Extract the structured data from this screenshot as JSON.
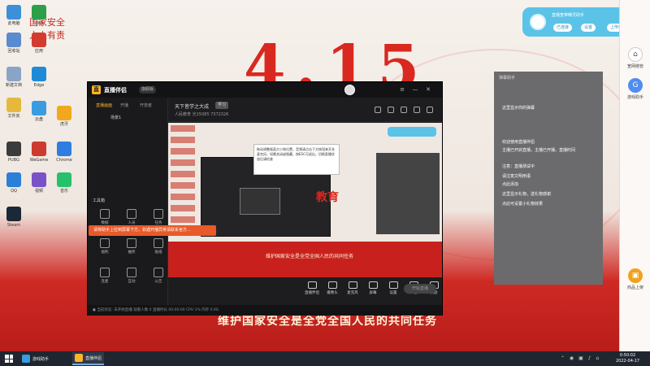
{
  "wallpaper": {
    "motto_line1": "国家安全",
    "motto_line2": "人人有责",
    "big_text": "4.15",
    "slogan": "维护国家安全是全党全国人民的共同任务"
  },
  "desktop_icons": [
    {
      "name": "computer",
      "label": "此电脑",
      "color": "#3d8fd8"
    },
    {
      "name": "recycle",
      "label": "回收站",
      "color": "#5a8bd0"
    },
    {
      "name": "file",
      "label": "新建文档",
      "color": "#8aa4c7"
    },
    {
      "name": "folder",
      "label": "文件夹",
      "color": "#e6b93c"
    },
    {
      "name": "app-360",
      "label": "360",
      "color": "#2c9f4b"
    },
    {
      "name": "pubg",
      "label": "PUBG",
      "color": "#3b3b3b"
    },
    {
      "name": "qq",
      "label": "QQ",
      "color": "#2a7fd8"
    },
    {
      "name": "steam",
      "label": "Steam",
      "color": "#1b2838"
    },
    {
      "name": "app-red",
      "label": "应用",
      "color": "#d33b30"
    },
    {
      "name": "weixin",
      "label": "WeGame",
      "color": "#cd3b2f"
    },
    {
      "name": "huya",
      "label": "虎牙",
      "color": "#f0a81c"
    },
    {
      "name": "chrome",
      "label": "Chrome",
      "color": "#2e7de0"
    },
    {
      "name": "edge",
      "label": "Edge",
      "color": "#1f8bd6"
    },
    {
      "name": "qq-music",
      "label": "音乐",
      "color": "#27c06b"
    },
    {
      "name": "cloud",
      "label": "云盘",
      "color": "#3a9be0"
    },
    {
      "name": "video",
      "label": "视频",
      "color": "#7a52c8"
    }
  ],
  "right_sidebar": {
    "item1_label": "宽网络管",
    "item2_label": "游戏助手",
    "item3_label": "商品上架"
  },
  "float_panel": {
    "title": "直播宽带精灵助手",
    "btn1": "已连接",
    "btn2": "设置",
    "btn3": "上传中"
  },
  "app": {
    "name": "直播伴侣",
    "version": "旗舰版",
    "left_tabs": [
      "直播画面",
      "开播",
      "开放者"
    ],
    "scene_label": "场景1",
    "tools_label": "工具箱",
    "tools": [
      "数据",
      "人员",
      "任务",
      "福利",
      "抽奖",
      "贴纸",
      "连麦",
      "互动",
      "公告"
    ],
    "warning_text": "请将助手上拉到屏幕下方，如遇开播异常请联系官方...",
    "room_title": "天下皆学之大成",
    "room_tag": "学习",
    "room_sub": "人民教育  光15085  7372326",
    "tooltip_text": "拖动调整画面大小和位置，音频请点击下方按钮来开关麦克风，如需关闭或隐藏，按ESC可退出，切换直播状态后请检查",
    "controls": [
      "直播伴侣",
      "摄像头",
      "麦克风",
      "屏幕",
      "设置",
      "声音",
      "美颜"
    ],
    "start_button": "开始直播",
    "status_text": "● 当前状态: 未开始直播  观看人数 0  直播时长 00:00:00  CPU 1%  内存 0.9G"
  },
  "chat": {
    "title": "弹幕助手",
    "lines": [
      "这里显示你的弹幕",
      "欢迎使用直播伴侣",
      "主播已开启直播，主播已开播，直播时间",
      "注意：直播测试中",
      "请注意文明用语",
      "点此添加",
      "这里显示礼物，送礼物感谢",
      "点此可设置小礼物效果"
    ]
  },
  "taskbar": {
    "app1": "游戏助手",
    "app2": "直播伴侣",
    "time": "0:50:02",
    "date": "2022-04-17"
  }
}
